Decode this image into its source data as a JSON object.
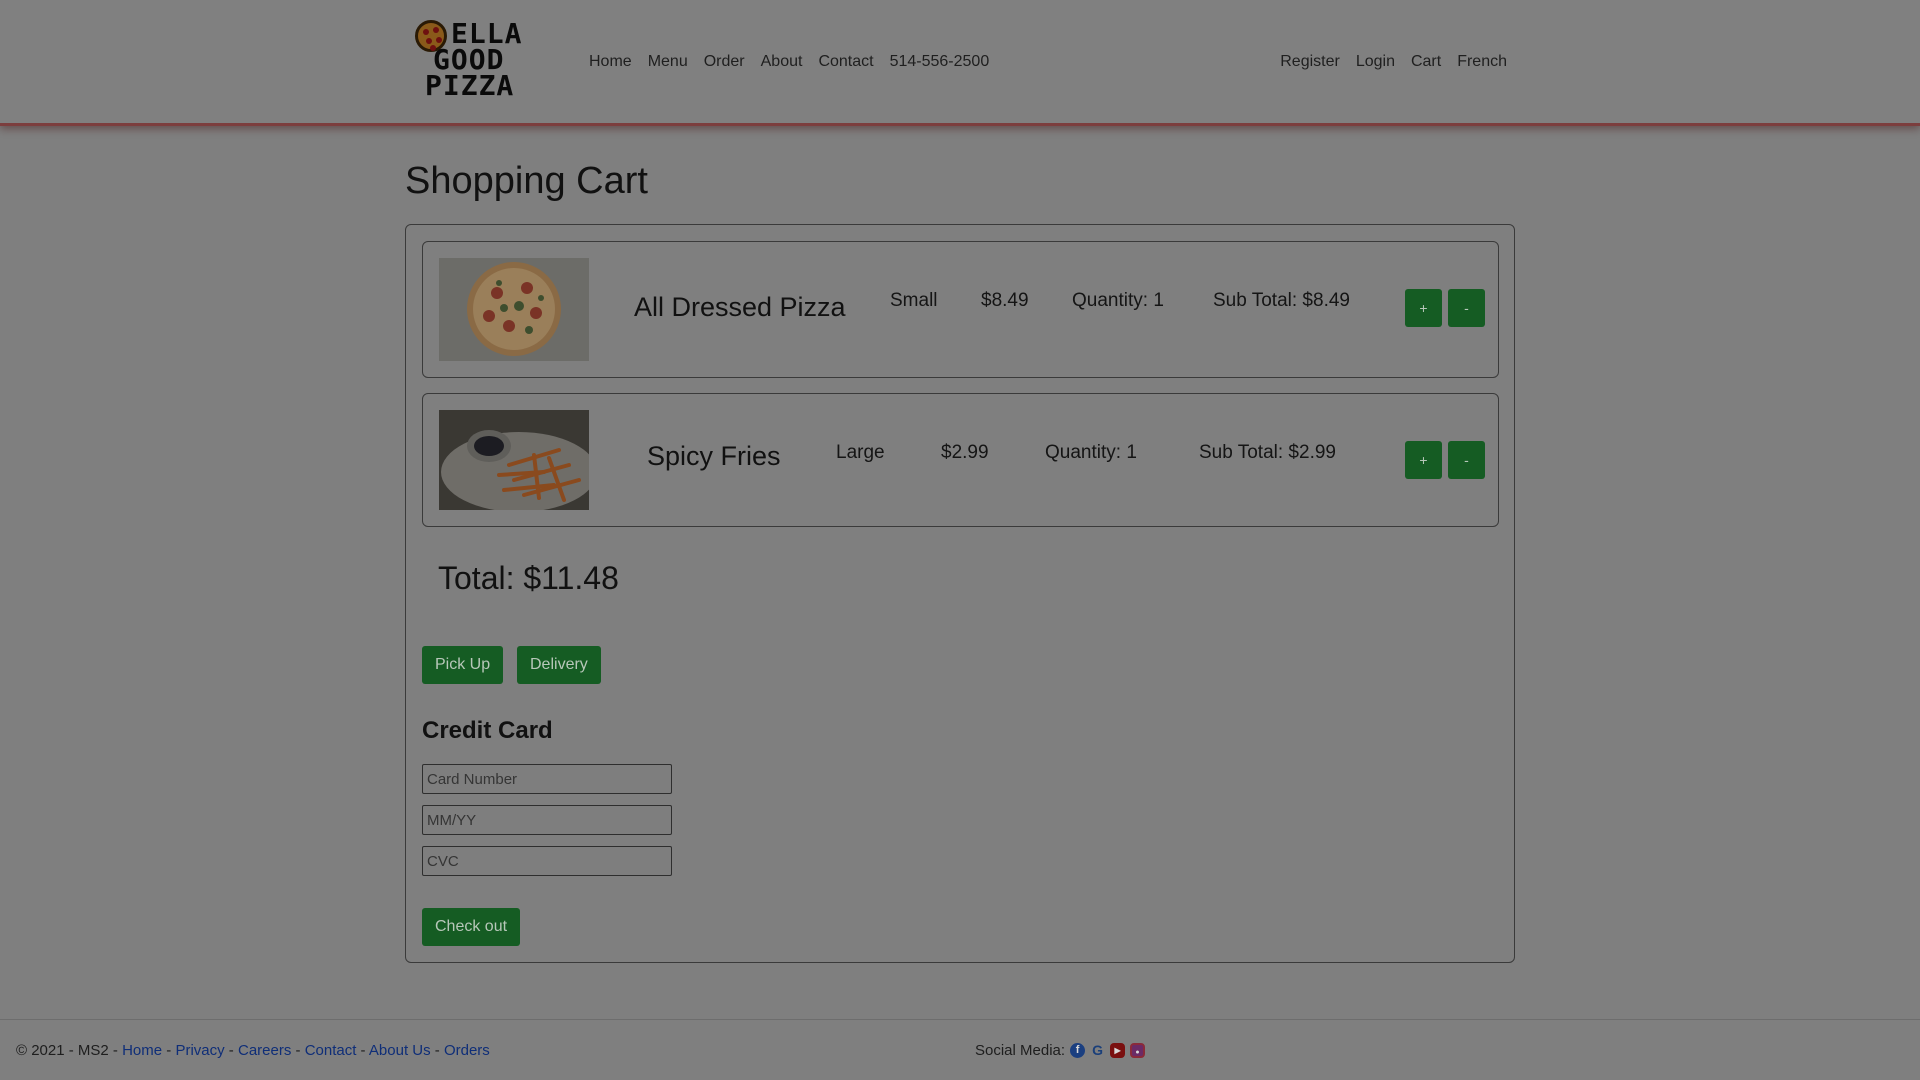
{
  "brand": {
    "logo_line1": "ELLA",
    "logo_line2": "GOOD",
    "logo_line3": "PIZZA"
  },
  "nav": {
    "left": [
      "Home",
      "Menu",
      "Order",
      "About",
      "Contact",
      "514-556-2500"
    ],
    "right": [
      "Register",
      "Login",
      "Cart",
      "French"
    ]
  },
  "page": {
    "title": "Shopping Cart"
  },
  "cart": {
    "items": [
      {
        "name": "All Dressed Pizza",
        "size": "Small",
        "price": "$8.49",
        "quantity": "Quantity: 1",
        "subtotal": "Sub Total: $8.49",
        "plus_label": "+",
        "minus_label": "-"
      },
      {
        "name": "Spicy Fries",
        "size": "Large",
        "price": "$2.99",
        "quantity": "Quantity: 1",
        "subtotal": "Sub Total: $2.99",
        "plus_label": "+",
        "minus_label": "-"
      }
    ],
    "total": "Total: $11.48",
    "pickup_label": "Pick Up",
    "delivery_label": "Delivery"
  },
  "payment": {
    "title": "Credit Card",
    "card_number_placeholder": "Card Number",
    "expiry_placeholder": "MM/YY",
    "cvc_placeholder": "CVC",
    "checkout_label": "Check out"
  },
  "footer": {
    "copyright": "© 2021 - MS2 - ",
    "links": [
      "Home",
      "Privacy",
      "Careers",
      "Contact",
      "About Us",
      "Orders"
    ],
    "separator": " - ",
    "social_label": "Social Media:",
    "social_icons": [
      "facebook-icon",
      "google-icon",
      "youtube-icon",
      "instagram-icon"
    ]
  },
  "colors": {
    "accent_green": "#155c23",
    "background": "#7f7f7f",
    "link_blue": "#0f2e78"
  }
}
